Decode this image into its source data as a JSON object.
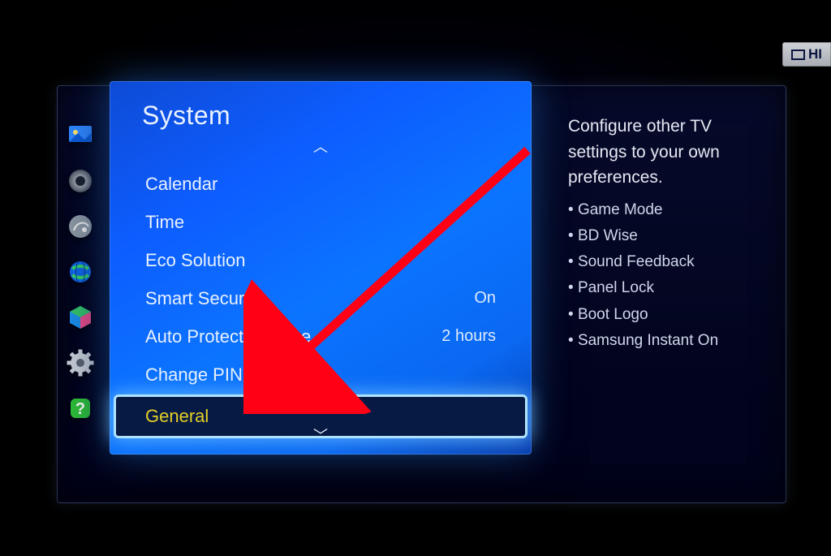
{
  "badge": {
    "text": "HI"
  },
  "sidebar_icons": [
    {
      "name": "picture-icon",
      "type": "picture"
    },
    {
      "name": "sound-icon",
      "type": "speaker"
    },
    {
      "name": "channel-icon",
      "type": "satellite"
    },
    {
      "name": "network-icon",
      "type": "globe"
    },
    {
      "name": "smarthub-icon",
      "type": "cube"
    },
    {
      "name": "system-icon",
      "type": "gear"
    },
    {
      "name": "support-icon",
      "type": "question"
    }
  ],
  "menu": {
    "title": "System",
    "scroll_up": "︿",
    "scroll_down": "﹀",
    "items": [
      {
        "label": "Calendar",
        "value": "",
        "selected": false
      },
      {
        "label": "Time",
        "value": "",
        "selected": false
      },
      {
        "label": "Eco Solution",
        "value": "",
        "selected": false
      },
      {
        "label": "Smart Security",
        "value": "On",
        "selected": false
      },
      {
        "label": "Auto Protection Time",
        "value": "2 hours",
        "selected": false
      },
      {
        "label": "Change PIN",
        "value": "",
        "selected": false
      },
      {
        "label": "General",
        "value": "",
        "selected": true
      }
    ]
  },
  "description": {
    "text": "Configure other TV settings to your own preferences.",
    "bullets": [
      "Game Mode",
      "BD Wise",
      "Sound Feedback",
      "Panel Lock",
      "Boot Logo",
      "Samsung Instant On"
    ]
  },
  "annotation": {
    "arrow_color": "#ff0015"
  }
}
